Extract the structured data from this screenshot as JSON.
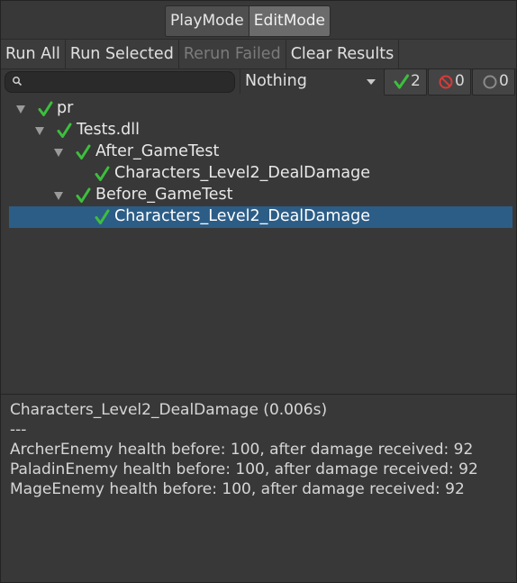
{
  "modes": {
    "play": "PlayMode",
    "edit": "EditMode",
    "active": "EditMode"
  },
  "toolbar": {
    "run_all": "Run All",
    "run_selected": "Run Selected",
    "rerun_failed": "Rerun Failed",
    "clear_results": "Clear Results"
  },
  "filter": {
    "search_value": "",
    "category": "Nothing",
    "passed_count": "2",
    "failed_count": "0",
    "skipped_count": "0"
  },
  "tree": {
    "root": "pr",
    "assembly": "Tests.dll",
    "fixtures": [
      {
        "name": "After_GameTest",
        "tests": [
          "Characters_Level2_DealDamage"
        ]
      },
      {
        "name": "Before_GameTest",
        "tests": [
          "Characters_Level2_DealDamage"
        ]
      }
    ]
  },
  "output": {
    "title": "Characters_Level2_DealDamage (0.006s)",
    "separator": "---",
    "lines": [
      "ArcherEnemy health before: 100, after damage received: 92",
      "PaladinEnemy health before: 100, after damage received: 92",
      "MageEnemy health before: 100, after damage received: 92"
    ]
  },
  "colors": {
    "pass": "#3dbf3d",
    "fail": "#d83a3a",
    "selection": "#2c5d87",
    "background": "#383838"
  },
  "icons": [
    "search-icon",
    "dropdown-arrow-icon",
    "passed-icon",
    "failed-icon",
    "skipped-icon",
    "expand-triangle-icon"
  ]
}
